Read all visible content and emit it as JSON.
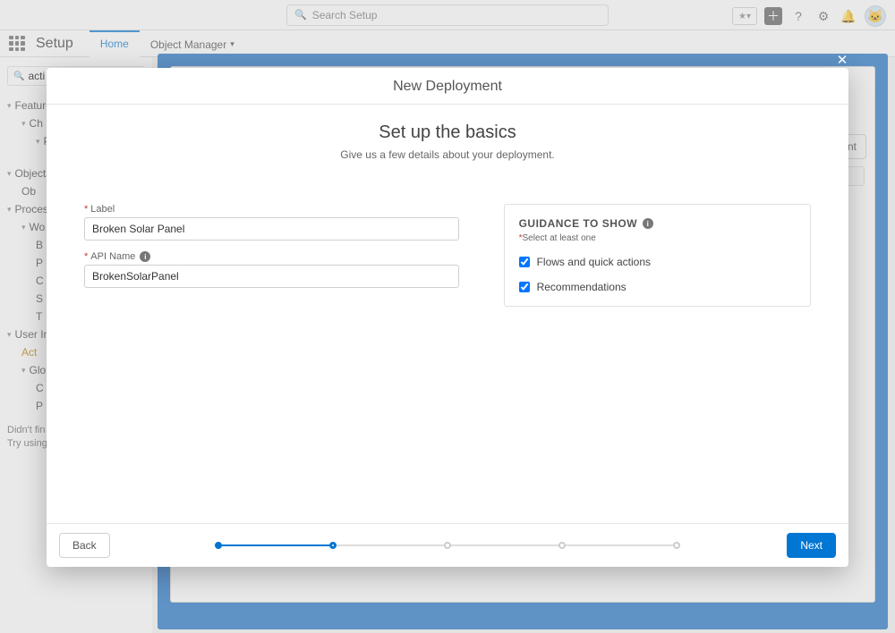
{
  "header": {
    "search_placeholder": "Search Setup",
    "app_title": "Setup",
    "tabs": {
      "home": "Home",
      "object_manager": "Object Manager"
    }
  },
  "sidebar": {
    "search_value": "acti",
    "sections": {
      "feature": "Feature",
      "ch": "Ch",
      "p": "P",
      "objects": "Objects",
      "ob": "Ob",
      "process": "Process",
      "wo": "Wo",
      "b": "B",
      "p2": "P",
      "c": "C",
      "s": "S",
      "t": "T",
      "user": "User In",
      "act": "Act",
      "glo": "Glo",
      "c2": "C",
      "p3": "P"
    },
    "no_results": "Didn't fin",
    "try_using": "Try using"
  },
  "page": {
    "new_deployment_btn": "ment"
  },
  "modal": {
    "title": "New Deployment",
    "heading": "Set up the basics",
    "subheading": "Give us a few details about your deployment.",
    "label_label": "Label",
    "label_value": "Broken Solar Panel",
    "api_label": "API Name",
    "api_value": "BrokenSolarPanel",
    "guidance_heading": "GUIDANCE TO SHOW",
    "guidance_select": "Select at least one",
    "checks": {
      "flows": "Flows and quick actions",
      "recs": "Recommendations"
    },
    "back": "Back",
    "next": "Next"
  }
}
